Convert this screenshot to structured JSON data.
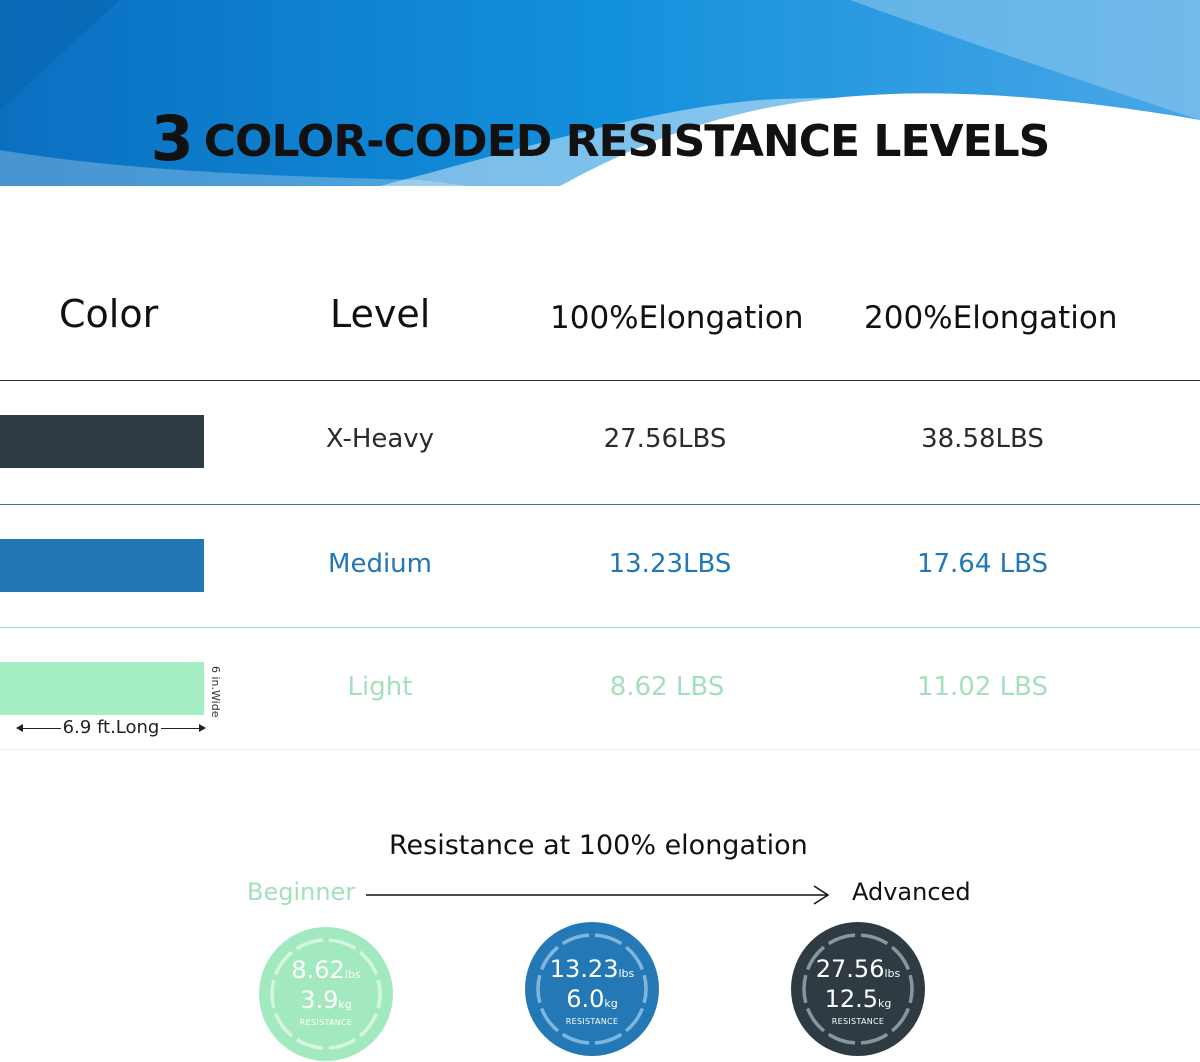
{
  "header": {
    "title_number": "3",
    "title_text": "COLOR-CODED RESISTANCE LEVELS"
  },
  "table": {
    "columns": [
      "Color",
      "Level",
      "100%Elongation",
      "200%Elongation"
    ],
    "rows": [
      {
        "color": "#2f3b43",
        "level": "X-Heavy",
        "e100": "27.56LBS",
        "e200": "38.58LBS",
        "text_color": "#2b2b2b",
        "rule_color": "#2a7ab8"
      },
      {
        "color": "#2277b5",
        "level": "Medium",
        "e100": "13.23LBS",
        "e200": "17.64 LBS",
        "text_color": "#2277b5",
        "rule_color": "#a6dfb8"
      },
      {
        "color": "#a5eec3",
        "level": "Light",
        "e100": "8.62 LBS",
        "e200": "11.02 LBS",
        "text_color": "#a4e0bb",
        "rule_color": "#ececec"
      }
    ],
    "width_label": "6 in.Wide",
    "length_label": "6.9 ft.Long"
  },
  "progression": {
    "title": "Resistance at 100% elongation",
    "start_label": "Beginner",
    "end_label": "Advanced",
    "gauges": [
      {
        "lbs": "8.62",
        "lbs_unit": "lbs",
        "kg": "3.9",
        "kg_unit": "kg",
        "label": "RESISTANCE",
        "fill": "#a3e9bf",
        "ring": "#d4f6e1"
      },
      {
        "lbs": "13.23",
        "lbs_unit": "lbs",
        "kg": "6.0",
        "kg_unit": "kg",
        "label": "RESISTANCE",
        "fill": "#2478b6",
        "ring": "#7fb6de"
      },
      {
        "lbs": "27.56",
        "lbs_unit": "lbs",
        "kg": "12.5",
        "kg_unit": "kg",
        "label": "RESISTANCE",
        "fill": "#2e3b43",
        "ring": "#8a959c"
      }
    ]
  },
  "colors": {
    "banner_dark": "#0a7fcf",
    "banner_light": "#9fd0f0",
    "light_green": "#a5eec3",
    "medium_blue": "#2277b5",
    "heavy_dark": "#2f3b43"
  }
}
